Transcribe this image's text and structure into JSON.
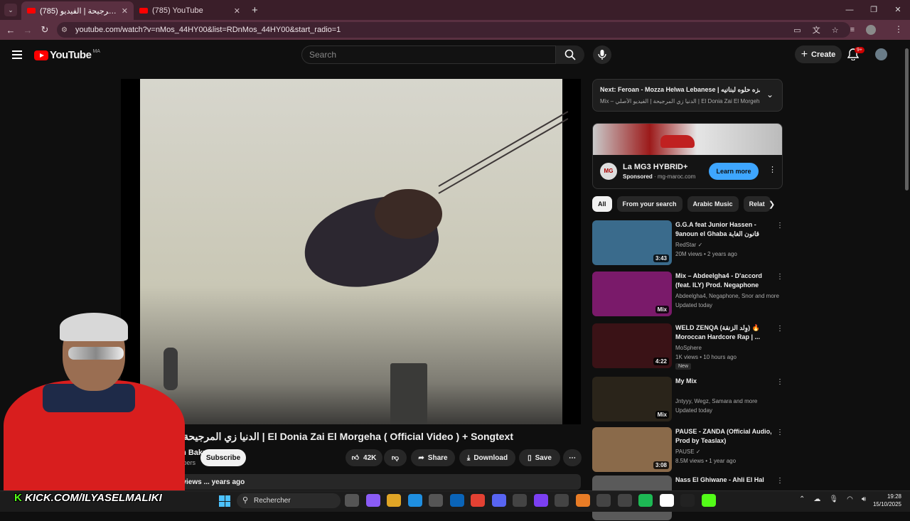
{
  "browser": {
    "tabs": [
      {
        "title": "(785) الدنيا زي المرجيحة | الفيديو",
        "active": true
      },
      {
        "title": "(785) YouTube",
        "active": false
      }
    ],
    "url": "youtube.com/watch?v=nMos_44HY00&list=RDnMos_44HY00&start_radio=1"
  },
  "header": {
    "logo": "YouTube",
    "country": "MA",
    "search_placeholder": "Search",
    "create_label": "Create",
    "notif_count": "9+"
  },
  "video": {
    "title": "الدنيا زي المرجيحة | El Donia Zai El Morgeha ( Official Video ) + Songtext",
    "channel": "...ham Bakr",
    "subscribers": "...K subscribers",
    "subscribe_label": "Subscribe",
    "likes": "42K",
    "share_label": "Share",
    "download_label": "Download",
    "save_label": "Save",
    "desc_meta": "...M views ... years ago"
  },
  "up_next": {
    "line1": "Next: Feroan - Mozza Helwa Lebanese | مزه حلوه لبنانيه ...",
    "line2": "Mix – الدنيا زي المرجيحة | الفيديو الأصلي | El Donia Zai El Morgeha ( ..."
  },
  "ad": {
    "title": "La MG3 HYBRID+",
    "sponsored": "Sponsored",
    "domain": "mg-maroc.com",
    "cta": "Learn more",
    "logo": "MG"
  },
  "chips": [
    "All",
    "From your search",
    "Arabic Music",
    "Relat"
  ],
  "related": [
    {
      "title": "G.G.A feat Junior Hassen - 9anoun el Ghaba قانون الغابة",
      "channel": "RedStar ✓",
      "meta": "20M views • 2 years ago",
      "duration": "3:43",
      "color": "#3a6b8c"
    },
    {
      "title": "Mix – Abdeelgha4 - D'accord (feat. ILY) Prod. Negaphone",
      "channel": "Abdeelgha4, Negaphone, Snor and more",
      "meta": "Updated today",
      "duration": "Mix",
      "color": "#7a1a6a"
    },
    {
      "title": "WELD ZENQA (وِلد الزنقة) 🔥 Moroccan Hardcore Rap | ...",
      "channel": "MoSphere",
      "meta": "1K views • 10 hours ago",
      "duration": "4:22",
      "badge": "New",
      "color": "#3a1216"
    },
    {
      "title": "My Mix",
      "channel": "Jntyyy, Wegz, Samara and more",
      "meta": "Updated today",
      "duration": "Mix",
      "color": "#2a241a"
    },
    {
      "title": "PAUSE - ZANDA (Official Audio, Prod by Teaslax)",
      "channel": "PAUSE ✓",
      "meta": "8.5M views • 1 year ago",
      "duration": "3:08",
      "color": "#8a6a4a"
    },
    {
      "title": "Nass El Ghiwane - Ahli El Hal",
      "channel": "",
      "meta": "",
      "duration": "",
      "color": "#5a5a5a"
    }
  ],
  "taskbar": {
    "kick_prefix": "K",
    "kick_text": "KICK.COM/ILYASELMALIKI",
    "search_label": "Rechercher",
    "time": "19:28",
    "date": "15/10/2025"
  }
}
